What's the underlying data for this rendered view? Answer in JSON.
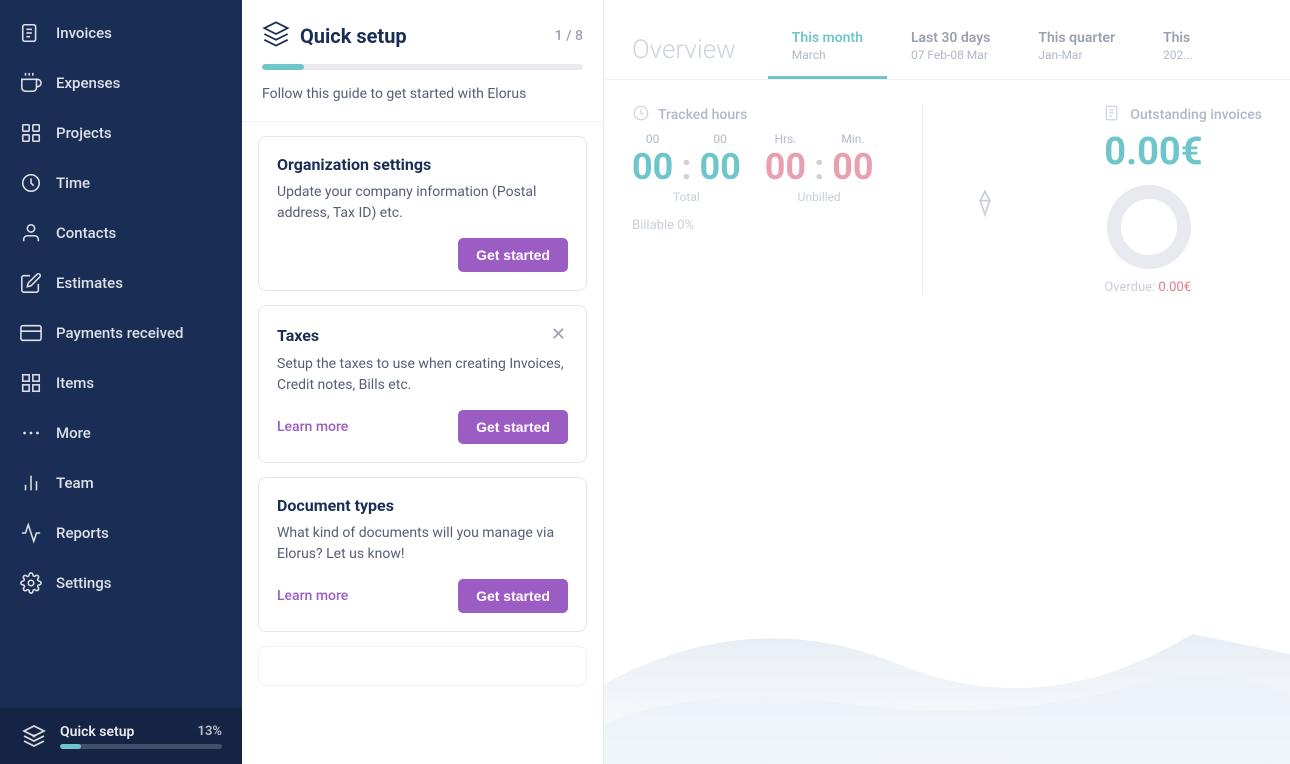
{
  "sidebar": {
    "items": [
      {
        "id": "invoices",
        "label": "Invoices",
        "icon": "file-text"
      },
      {
        "id": "expenses",
        "label": "Expenses",
        "icon": "coffee"
      },
      {
        "id": "projects",
        "label": "Projects",
        "icon": "layers"
      },
      {
        "id": "time",
        "label": "Time",
        "icon": "clock"
      },
      {
        "id": "contacts",
        "label": "Contacts",
        "icon": "user"
      },
      {
        "id": "estimates",
        "label": "Estimates",
        "icon": "edit"
      },
      {
        "id": "payments-received",
        "label": "Payments received",
        "icon": "credit-card"
      },
      {
        "id": "items",
        "label": "Items",
        "icon": "grid"
      },
      {
        "id": "more",
        "label": "More",
        "icon": "more-horizontal"
      },
      {
        "id": "team",
        "label": "Team",
        "icon": "bar-chart-2"
      },
      {
        "id": "reports",
        "label": "Reports",
        "icon": "trending-up"
      },
      {
        "id": "settings",
        "label": "Settings",
        "icon": "settings"
      }
    ],
    "quick_setup": {
      "label": "Quick setup",
      "badge": "13%",
      "progress": 13
    }
  },
  "quick_setup": {
    "title": "Quick setup",
    "step": "1 / 8",
    "description": "Follow this guide to get started with Elorus",
    "progress": 13,
    "cards": [
      {
        "id": "org-settings",
        "title": "Organization settings",
        "description": "Update your company information (Postal address, Tax ID) etc.",
        "has_close": false,
        "has_learn_more": false,
        "get_started_label": "Get started"
      },
      {
        "id": "taxes",
        "title": "Taxes",
        "description": "Setup the taxes to use when creating Invoices, Credit notes, Bills etc.",
        "has_close": true,
        "has_learn_more": true,
        "learn_more_label": "Learn more",
        "get_started_label": "Get started"
      },
      {
        "id": "document-types",
        "title": "Document types",
        "description": "What kind of documents will you manage via Elorus? Let us know!",
        "has_close": false,
        "has_learn_more": true,
        "learn_more_label": "Learn more",
        "get_started_label": "Get started"
      }
    ]
  },
  "overview": {
    "title": "Overview",
    "tabs": [
      {
        "id": "this-month",
        "label": "This month",
        "sub": "March",
        "active": true
      },
      {
        "id": "last-30",
        "label": "Last 30 days",
        "sub": "07 Feb-08 Mar",
        "active": false
      },
      {
        "id": "this-quarter",
        "label": "This quarter",
        "sub": "Jan-Mar",
        "active": false
      },
      {
        "id": "this-year",
        "label": "This",
        "sub": "202...",
        "active": false
      }
    ],
    "tracked_hours": {
      "label": "Tracked hours",
      "total": {
        "hrs": "00",
        "min": "00",
        "label": "Total"
      },
      "unbilled": {
        "hrs": "00",
        "min": "00",
        "label": "Unbilled"
      },
      "billable": "Billable 0%"
    },
    "outstanding_invoices": {
      "label": "Outstanding invoices",
      "value": "0.00€",
      "overdue_label": "Overdue:",
      "overdue_value": "0.00€"
    }
  }
}
